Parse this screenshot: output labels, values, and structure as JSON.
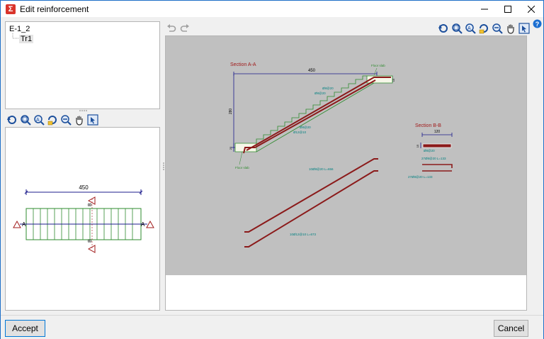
{
  "window": {
    "title": "Edit reinforcement",
    "app_icon_glyph": "Σ",
    "controls": [
      "minimize",
      "maximize",
      "close"
    ]
  },
  "tree": {
    "root": "E-1_2",
    "child": "Tr1"
  },
  "plan": {
    "dimension": "450",
    "section_a_left": "A",
    "section_a_right": "A",
    "section_b_top": "B",
    "section_b_bottom": "B"
  },
  "drawing": {
    "section_aa_title": "Section A-A",
    "section_bb_title": "Section B-B",
    "dim_length": "450",
    "dim_height": "280",
    "dim_bb_width": "120",
    "dim_small_1": "20",
    "dim_small_2": "15",
    "dim_small_3": "15",
    "floor_slab_top": "Floor slab",
    "floor_slab_bottom": "Floor slab",
    "label_top_1": "Ø8@20",
    "label_top_2": "Ø8@20",
    "label_mid_1": "Ø8@20",
    "label_mid_2": "Ø12@10",
    "label_bb_1": "Ø8@20",
    "label_bb_2": "27Ø8@20 L=133",
    "label_bb_3": "27Ø8@20 L=133",
    "label_bar_upper": "10Ø8@20 L=656",
    "label_bar_lower": "10Ø12@10 L=673"
  },
  "icons": {
    "undo": "undo-icon",
    "redo": "redo-icon",
    "help": "help-icon",
    "toolbar": [
      "reset-view-icon",
      "zoom-window-icon",
      "zoom-all-icon",
      "refresh-icon",
      "zoom-out-icon",
      "pan-hand-icon",
      "select-icon"
    ]
  },
  "buttons": {
    "accept": "Accept",
    "cancel": "Cancel"
  },
  "colors": {
    "accent": "#0078d7",
    "rebar": "#8b1a1a",
    "dimension": "#1c1c8c",
    "label": "#008080",
    "concrete": "#2e8b2e",
    "drawing_bg": "#c0c0c0"
  }
}
